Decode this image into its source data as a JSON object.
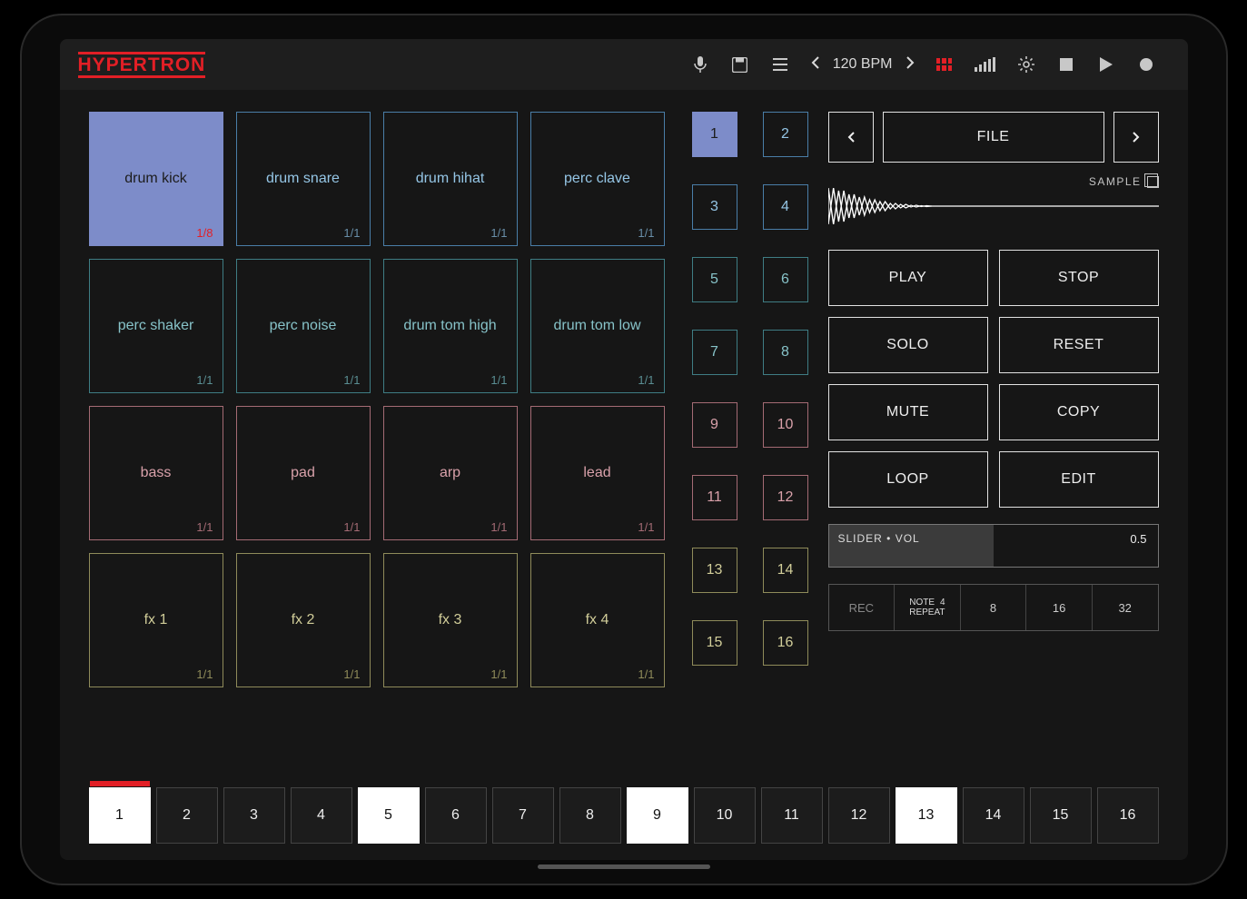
{
  "app": {
    "name": "HYPERTRON"
  },
  "topbar": {
    "bpm_label": "120 BPM"
  },
  "pads": [
    {
      "label": "drum kick",
      "frac": "1/8",
      "row": "blue",
      "selected": true
    },
    {
      "label": "drum snare",
      "frac": "1/1",
      "row": "blue"
    },
    {
      "label": "drum hihat",
      "frac": "1/1",
      "row": "blue"
    },
    {
      "label": "perc clave",
      "frac": "1/1",
      "row": "blue"
    },
    {
      "label": "perc shaker",
      "frac": "1/1",
      "row": "teal"
    },
    {
      "label": "perc noise",
      "frac": "1/1",
      "row": "teal"
    },
    {
      "label": "drum tom high",
      "frac": "1/1",
      "row": "teal"
    },
    {
      "label": "drum tom low",
      "frac": "1/1",
      "row": "teal"
    },
    {
      "label": "bass",
      "frac": "1/1",
      "row": "pink"
    },
    {
      "label": "pad",
      "frac": "1/1",
      "row": "pink"
    },
    {
      "label": "arp",
      "frac": "1/1",
      "row": "pink"
    },
    {
      "label": "lead",
      "frac": "1/1",
      "row": "pink"
    },
    {
      "label": "fx 1",
      "frac": "1/1",
      "row": "yellow"
    },
    {
      "label": "fx 2",
      "frac": "1/1",
      "row": "yellow"
    },
    {
      "label": "fx 3",
      "frac": "1/1",
      "row": "yellow"
    },
    {
      "label": "fx 4",
      "frac": "1/1",
      "row": "yellow"
    }
  ],
  "mini": [
    {
      "n": "1",
      "row": "blue",
      "selected": true
    },
    {
      "n": "2",
      "row": "blue"
    },
    {
      "n": "3",
      "row": "blue"
    },
    {
      "n": "4",
      "row": "blue"
    },
    {
      "n": "5",
      "row": "teal"
    },
    {
      "n": "6",
      "row": "teal"
    },
    {
      "n": "7",
      "row": "teal"
    },
    {
      "n": "8",
      "row": "teal"
    },
    {
      "n": "9",
      "row": "pink"
    },
    {
      "n": "10",
      "row": "pink"
    },
    {
      "n": "11",
      "row": "pink"
    },
    {
      "n": "12",
      "row": "pink"
    },
    {
      "n": "13",
      "row": "yellow"
    },
    {
      "n": "14",
      "row": "yellow"
    },
    {
      "n": "15",
      "row": "yellow"
    },
    {
      "n": "16",
      "row": "yellow"
    }
  ],
  "file": {
    "label": "FILE"
  },
  "sample": {
    "label": "SAMPLE"
  },
  "actions": {
    "play": "PLAY",
    "stop": "STOP",
    "solo": "SOLO",
    "reset": "RESET",
    "mute": "MUTE",
    "copy": "COPY",
    "loop": "LOOP",
    "edit": "EDIT"
  },
  "slider": {
    "label": "SLIDER • VOL",
    "value": "0.5"
  },
  "rec": {
    "rec": "REC",
    "note_top": "NOTE",
    "note_val": "4",
    "note_bot": "REPEAT",
    "r8": "8",
    "r16": "16",
    "r32": "32"
  },
  "steps": [
    {
      "n": "1",
      "active": true,
      "pos": true
    },
    {
      "n": "2"
    },
    {
      "n": "3"
    },
    {
      "n": "4"
    },
    {
      "n": "5",
      "active": true
    },
    {
      "n": "6"
    },
    {
      "n": "7"
    },
    {
      "n": "8"
    },
    {
      "n": "9",
      "active": true
    },
    {
      "n": "10"
    },
    {
      "n": "11"
    },
    {
      "n": "12"
    },
    {
      "n": "13",
      "active": true
    },
    {
      "n": "14"
    },
    {
      "n": "15"
    },
    {
      "n": "16"
    }
  ]
}
